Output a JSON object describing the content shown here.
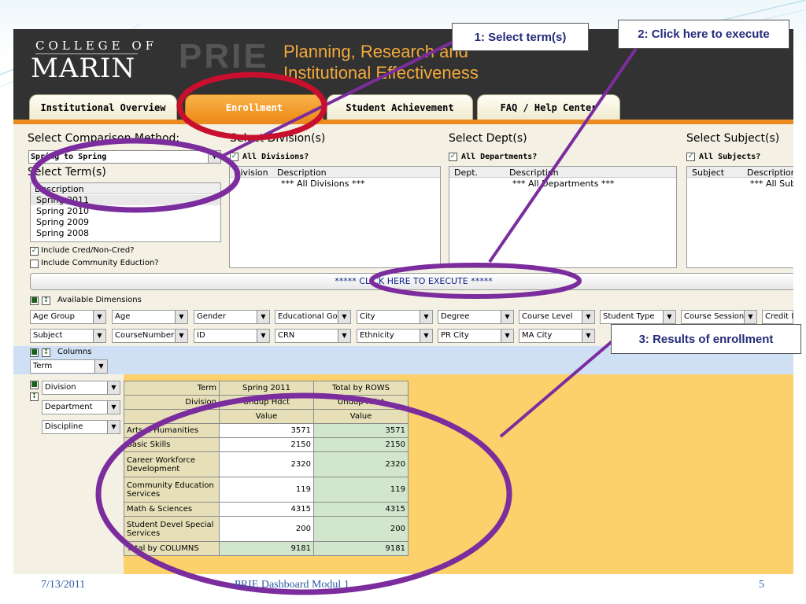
{
  "header": {
    "logo_top": "COLLEGE OF",
    "logo_main": "MARIN",
    "prie": "PRIE",
    "prie_line1": "Planning, Research and",
    "prie_line2": "Institutional Effectiveness"
  },
  "tabs": [
    {
      "label": "Institutional Overview",
      "active": false
    },
    {
      "label": "Enrollment",
      "active": true
    },
    {
      "label": "Student Achievement",
      "active": false
    },
    {
      "label": "FAQ / Help Center",
      "active": false
    }
  ],
  "comparison": {
    "label": "Select Comparison Method:",
    "value": "Spring to Spring"
  },
  "term": {
    "label": "Select Term(s)",
    "column": "Description",
    "options": [
      "Spring 2011",
      "Spring 2010",
      "Spring 2009",
      "Spring 2008"
    ],
    "selected": "Spring 2011"
  },
  "checks": {
    "cred": "Include Cred/Non-Cred?",
    "community": "Include Community Eduction?"
  },
  "division": {
    "label": "Select Division(s)",
    "all": "All Divisions?",
    "col1": "Division",
    "col2": "Description",
    "row": "*** All Divisions ***"
  },
  "dept": {
    "label": "Select Dept(s)",
    "all": "All Departments?",
    "col1": "Dept.",
    "col2": "Description",
    "row": "*** All Departments ***"
  },
  "subject": {
    "label": "Select Subject(s)",
    "all": "All Subjects?",
    "col1": "Subject",
    "col2": "Description",
    "row": "*** All Sub"
  },
  "execute_label": "***** CLICK HERE TO EXECUTE *****",
  "dimensions": {
    "label": "Available Dimensions",
    "row1": [
      "Age Group",
      "Age",
      "Gender",
      "Educational Goal",
      "City",
      "Degree",
      "Course Level",
      "Student Type",
      "Course Session",
      "Credit F"
    ],
    "row2": [
      "Subject",
      "CourseNumber",
      "ID",
      "CRN",
      "Ethnicity",
      "PR City",
      "MA City"
    ]
  },
  "columns": {
    "label": "Columns",
    "item": "Term"
  },
  "rows_fields": [
    "Division",
    "Department",
    "Discipline"
  ],
  "grid": {
    "term_label": "Term",
    "division_label": "Division",
    "col_spring": "Spring 2011",
    "col_total": "Total by ROWS",
    "measure": "Undup Hdct",
    "value_label": "Value",
    "rows": [
      {
        "label": "Arts & Humanities",
        "value": "3571",
        "total": "3571"
      },
      {
        "label": "Basic Skills",
        "value": "2150",
        "total": "2150"
      },
      {
        "label": "Career Workforce Development",
        "value": "2320",
        "total": "2320"
      },
      {
        "label": "Community Education Services",
        "value": "119",
        "total": "119"
      },
      {
        "label": "Math & Sciences",
        "value": "4315",
        "total": "4315"
      },
      {
        "label": "Student Devel Special Services",
        "value": "200",
        "total": "200"
      }
    ],
    "total_label": "Total by COLUMNS",
    "total_value": "9181",
    "total_total": "9181"
  },
  "callouts": {
    "c1": "1: Select term(s)",
    "c2": "2: Click here to execute",
    "c3": "3: Results of enrollment"
  },
  "footer": {
    "date": "7/13/2011",
    "title": "PRIE Dashboard Modul 1",
    "page": "5"
  },
  "colors": {
    "header": "#323232",
    "accent_orange": "#ea8b21",
    "annotation_purple": "#7b2d9e",
    "annotation_red": "#c8102e",
    "results_bg": "#fcd06a"
  }
}
